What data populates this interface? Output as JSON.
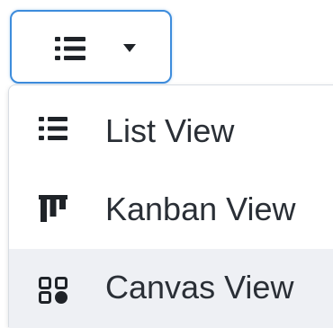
{
  "toggle": {
    "icon": "list-icon",
    "caret": "caret-down-icon",
    "accent_color": "#3d8cdc"
  },
  "menu": {
    "items": [
      {
        "label": "List View",
        "icon": "list-icon",
        "selected": false
      },
      {
        "label": "Kanban View",
        "icon": "kanban-icon",
        "selected": false
      },
      {
        "label": "Canvas View",
        "icon": "canvas-grid-icon",
        "selected": true
      }
    ],
    "hover_bg": "#eef0f4",
    "text_color": "#2a2f36",
    "icon_color": "#1f2328"
  }
}
